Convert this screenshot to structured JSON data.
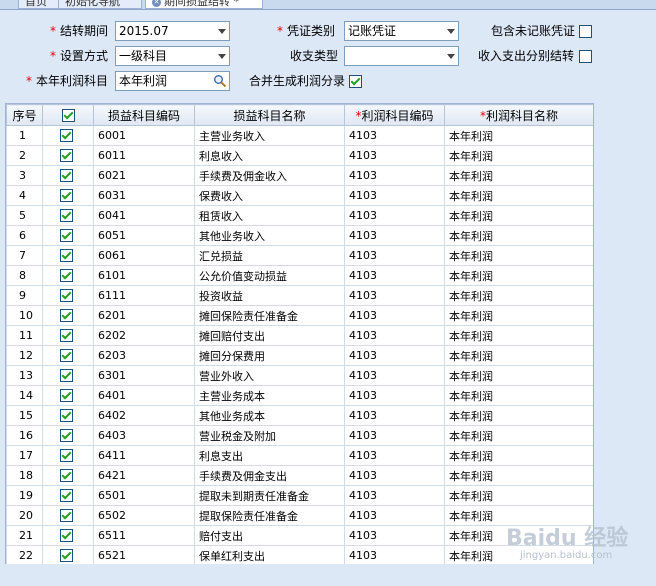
{
  "tabs": [
    {
      "label": "首页"
    },
    {
      "label": "初始化导航"
    },
    {
      "label": "期间损益结转",
      "close": "✕",
      "dirty": "*"
    }
  ],
  "form": {
    "period": {
      "label": "结转期间",
      "value": "2015.07",
      "required": "*"
    },
    "voucher_type": {
      "label": "凭证类别",
      "value": "记账凭证",
      "required": "*"
    },
    "include_unposted": {
      "label": "包含未记账凭证",
      "checked": false
    },
    "setting_mode": {
      "label": "设置方式",
      "value": "一级科目",
      "required": "*"
    },
    "income_expense_type": {
      "label": "收支类型",
      "value": ""
    },
    "separate_transfer": {
      "label": "收入支出分别结转",
      "checked": false
    },
    "profit_account": {
      "label": "本年利润科目",
      "value": "本年利润",
      "required": "*"
    },
    "merge_profit": {
      "label": "合并生成利润分录",
      "checked": true
    }
  },
  "grid": {
    "headers": {
      "seq": "序号",
      "pl_code": "损益科目编码",
      "pl_name": "损益科目名称",
      "profit_code": "利润科目编码",
      "profit_name": "利润科目名称",
      "required": "*"
    },
    "rows": [
      {
        "seq": "1",
        "pl_code": "6001",
        "pl_name": "主营业务收入",
        "profit_code": "4103",
        "profit_name": "本年利润"
      },
      {
        "seq": "2",
        "pl_code": "6011",
        "pl_name": "利息收入",
        "profit_code": "4103",
        "profit_name": "本年利润"
      },
      {
        "seq": "3",
        "pl_code": "6021",
        "pl_name": "手续费及佣金收入",
        "profit_code": "4103",
        "profit_name": "本年利润"
      },
      {
        "seq": "4",
        "pl_code": "6031",
        "pl_name": "保费收入",
        "profit_code": "4103",
        "profit_name": "本年利润"
      },
      {
        "seq": "5",
        "pl_code": "6041",
        "pl_name": "租赁收入",
        "profit_code": "4103",
        "profit_name": "本年利润"
      },
      {
        "seq": "6",
        "pl_code": "6051",
        "pl_name": "其他业务收入",
        "profit_code": "4103",
        "profit_name": "本年利润"
      },
      {
        "seq": "7",
        "pl_code": "6061",
        "pl_name": "汇兑损益",
        "profit_code": "4103",
        "profit_name": "本年利润"
      },
      {
        "seq": "8",
        "pl_code": "6101",
        "pl_name": "公允价值变动损益",
        "profit_code": "4103",
        "profit_name": "本年利润"
      },
      {
        "seq": "9",
        "pl_code": "6111",
        "pl_name": "投资收益",
        "profit_code": "4103",
        "profit_name": "本年利润"
      },
      {
        "seq": "10",
        "pl_code": "6201",
        "pl_name": "摊回保险责任准备金",
        "profit_code": "4103",
        "profit_name": "本年利润"
      },
      {
        "seq": "11",
        "pl_code": "6202",
        "pl_name": "摊回赔付支出",
        "profit_code": "4103",
        "profit_name": "本年利润"
      },
      {
        "seq": "12",
        "pl_code": "6203",
        "pl_name": "摊回分保费用",
        "profit_code": "4103",
        "profit_name": "本年利润"
      },
      {
        "seq": "13",
        "pl_code": "6301",
        "pl_name": "营业外收入",
        "profit_code": "4103",
        "profit_name": "本年利润"
      },
      {
        "seq": "14",
        "pl_code": "6401",
        "pl_name": "主营业务成本",
        "profit_code": "4103",
        "profit_name": "本年利润"
      },
      {
        "seq": "15",
        "pl_code": "6402",
        "pl_name": "其他业务成本",
        "profit_code": "4103",
        "profit_name": "本年利润"
      },
      {
        "seq": "16",
        "pl_code": "6403",
        "pl_name": "营业税金及附加",
        "profit_code": "4103",
        "profit_name": "本年利润"
      },
      {
        "seq": "17",
        "pl_code": "6411",
        "pl_name": "利息支出",
        "profit_code": "4103",
        "profit_name": "本年利润"
      },
      {
        "seq": "18",
        "pl_code": "6421",
        "pl_name": "手续费及佣金支出",
        "profit_code": "4103",
        "profit_name": "本年利润"
      },
      {
        "seq": "19",
        "pl_code": "6501",
        "pl_name": "提取未到期责任准备金",
        "profit_code": "4103",
        "profit_name": "本年利润"
      },
      {
        "seq": "20",
        "pl_code": "6502",
        "pl_name": "提取保险责任准备金",
        "profit_code": "4103",
        "profit_name": "本年利润"
      },
      {
        "seq": "21",
        "pl_code": "6511",
        "pl_name": "赔付支出",
        "profit_code": "4103",
        "profit_name": "本年利润"
      },
      {
        "seq": "22",
        "pl_code": "6521",
        "pl_name": "保单红利支出",
        "profit_code": "4103",
        "profit_name": "本年利润"
      }
    ]
  },
  "watermark": {
    "main": "Baidu 经验",
    "sub": "jingyan.baidu.com"
  }
}
